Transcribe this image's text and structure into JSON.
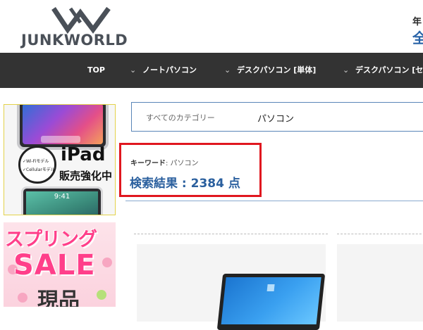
{
  "header": {
    "logo_text": "JUNKWORLD",
    "right_top": "年",
    "right_bottom": "全"
  },
  "nav": {
    "items": [
      {
        "label": "TOP"
      },
      {
        "label": "ノートパソコン"
      },
      {
        "label": "デスクパソコン [単体]"
      },
      {
        "label": "デスクパソコン [セ"
      }
    ]
  },
  "banners": {
    "ipad": {
      "circle_line1": "✓Wi-Fiモデル",
      "circle_line2": "✓Cellularモデル",
      "title": "iPad",
      "subtitle": "販売強化中",
      "time": "9:41"
    },
    "sale": {
      "line1": "スプリング",
      "line2": "SALE",
      "line3": "現品"
    }
  },
  "search": {
    "category": "すべてのカテゴリー",
    "value": "パソコン"
  },
  "results": {
    "keyword_label": "キーワード",
    "keyword_value": ": パソコン",
    "count_text": "検索結果 : 2384 点"
  },
  "colors": {
    "nav_bg": "#333333",
    "highlight_border": "#e0171f",
    "result_text": "#2a5f9e",
    "search_border": "#5a86b8"
  }
}
